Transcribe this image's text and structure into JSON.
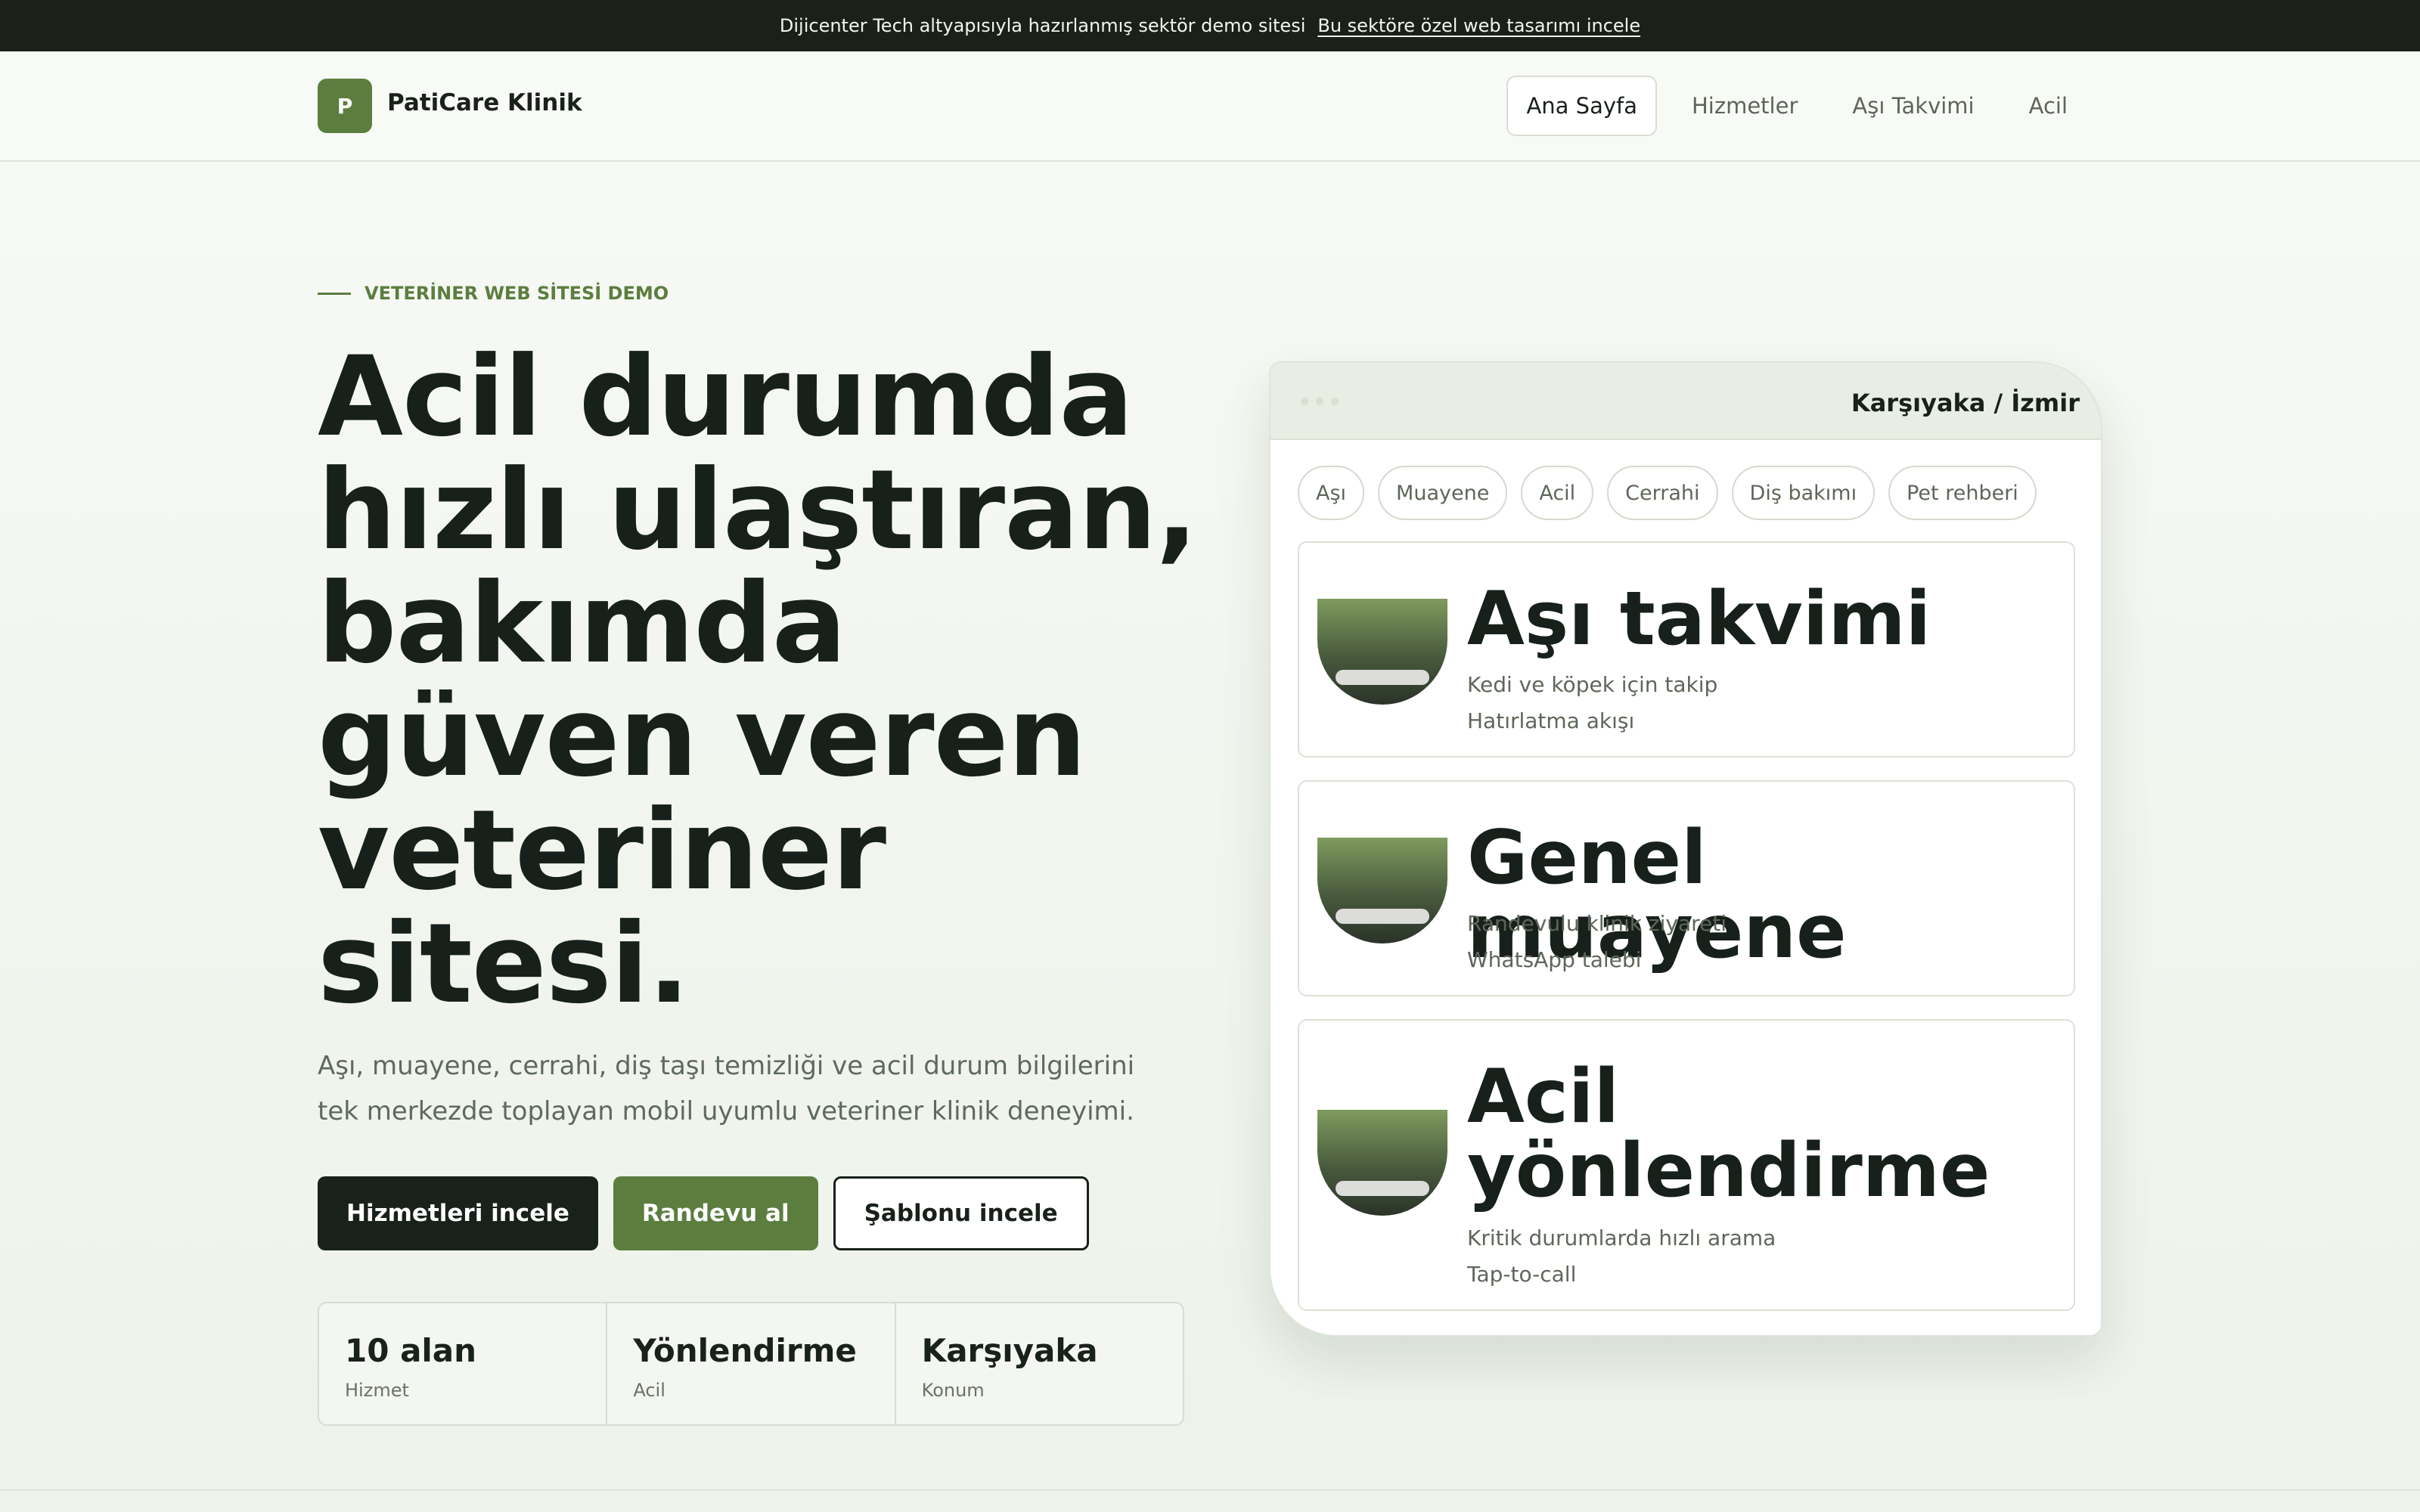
{
  "banner": {
    "text": "Dijicenter Tech altyapısıyla hazırlanmış sektör demo sitesi",
    "link": "Bu sektöre özel web tasarımı incele"
  },
  "header": {
    "logo_letter": "P",
    "brand": "PatiCare Klinik",
    "nav": [
      "Ana Sayfa",
      "Hizmetler",
      "Aşı Takvimi",
      "Acil"
    ],
    "active_nav": "Ana Sayfa"
  },
  "hero": {
    "eyebrow": "VETERİNER WEB SİTESİ DEMO",
    "title": "Acil durumda hızlı ulaştıran, bakımda güven veren veteriner sitesi.",
    "description": "Aşı, muayene, cerrahi, diş taşı temizliği ve acil durum bilgilerini tek merkezde toplayan mobil uyumlu veteriner klinik deneyimi.",
    "buttons": {
      "services": "Hizmetleri incele",
      "appointment": "Randevu al",
      "template": "Şablonu incele"
    },
    "stats": [
      {
        "value": "10 alan",
        "label": "Hizmet"
      },
      {
        "value": "Yönlendirme",
        "label": "Acil"
      },
      {
        "value": "Karşıyaka",
        "label": "Konum"
      }
    ]
  },
  "panel": {
    "location": "Karşıyaka / İzmir",
    "chips": [
      "Aşı",
      "Muayene",
      "Acil",
      "Cerrahi",
      "Diş bakımı",
      "Pet rehberi"
    ],
    "cards": [
      {
        "title": "Aşı takvimi",
        "line1": "Kedi ve köpek için takip",
        "line2": "Hatırlatma akışı"
      },
      {
        "title": "Genel muayene",
        "line1": "Randevulu klinik ziyareti",
        "line2": "WhatsApp talebi"
      },
      {
        "title": "Acil yönlendirme",
        "line1": "Kritik durumlarda hızlı arama",
        "line2": "Tap-to-call"
      }
    ]
  },
  "colors": {
    "brand_green": "#5b7e3f",
    "dark": "#18211a",
    "banner_bg": "#1b2119"
  }
}
